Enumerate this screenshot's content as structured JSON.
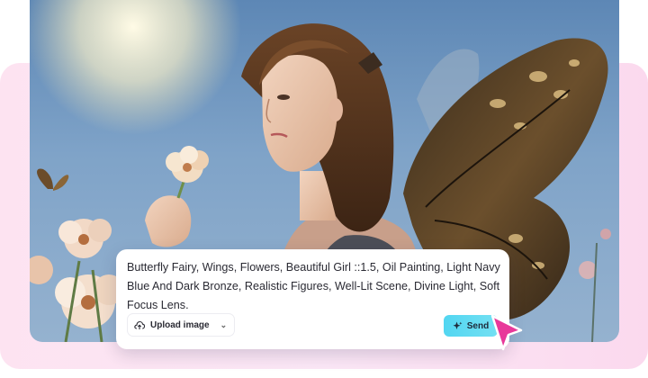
{
  "prompt": {
    "text": "Butterfly Fairy, Wings, Flowers, Beautiful Girl ::1.5, Oil Painting, Light Navy Blue And Dark Bronze, Realistic Figures, Well-Lit Scene, Divine Light, Soft Focus Lens."
  },
  "upload": {
    "label": "Upload image",
    "icon": "cloud-upload-icon"
  },
  "send": {
    "label": "Send",
    "icon": "sparkle-icon"
  },
  "colors": {
    "accent": "#52d6f1",
    "backdrop": "#fde3f1",
    "cursor": "#e8389a"
  }
}
